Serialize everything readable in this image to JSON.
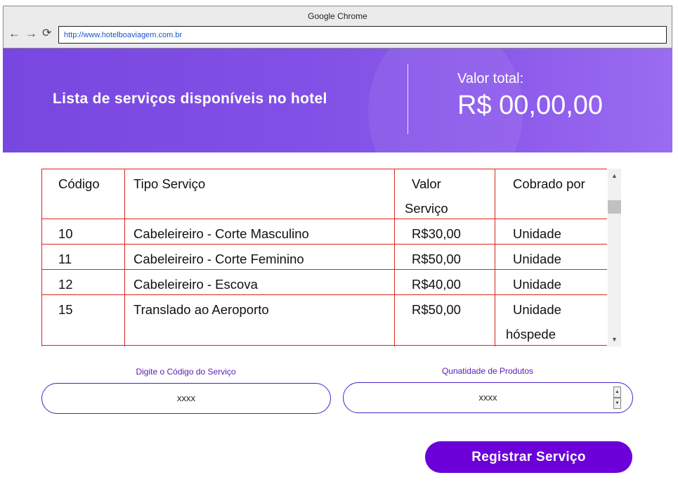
{
  "browser": {
    "title": "Google Chrome",
    "url": "http://www.hotelboaviagem.com.br",
    "icons": [
      "arrow-left-icon",
      "arrow-right-icon",
      "reload-icon"
    ]
  },
  "banner": {
    "title": "Lista de serviços disponíveis no hotel",
    "total_label": "Valor total:",
    "total_value": "R$ 00,00,00"
  },
  "table": {
    "headers": {
      "code": "Código",
      "type": "Tipo Serviço",
      "value_line1": "Valor",
      "value_line2": "Serviço",
      "charged": "Cobrado por"
    },
    "rows": [
      {
        "code": "10",
        "type": "Cabeleireiro - Corte Masculino",
        "value": "R$30,00",
        "charged": "Unidade",
        "charged_line2": ""
      },
      {
        "code": "11",
        "type": "Cabeleireiro - Corte Feminino",
        "value": "R$50,00",
        "charged": "Unidade",
        "charged_line2": ""
      },
      {
        "code": "12",
        "type": "Cabeleireiro - Escova",
        "value": "R$40,00",
        "charged": "Unidade",
        "charged_line2": ""
      },
      {
        "code": "15",
        "type": "Translado ao Aeroporto",
        "value": "R$50,00",
        "charged": "Unidade",
        "charged_line2": "hóspede"
      }
    ]
  },
  "form": {
    "code_label": "Digite o Código do Serviço",
    "code_value": "xxxx",
    "qty_label": "Qunatidade de Produtos",
    "qty_value": "xxxx",
    "register_label": "Registrar Serviço"
  },
  "colors": {
    "banner": "#7f4fe5",
    "accent": "#6b00d9",
    "grid_lines": "#d9261c",
    "field_border": "#4a20c8"
  }
}
